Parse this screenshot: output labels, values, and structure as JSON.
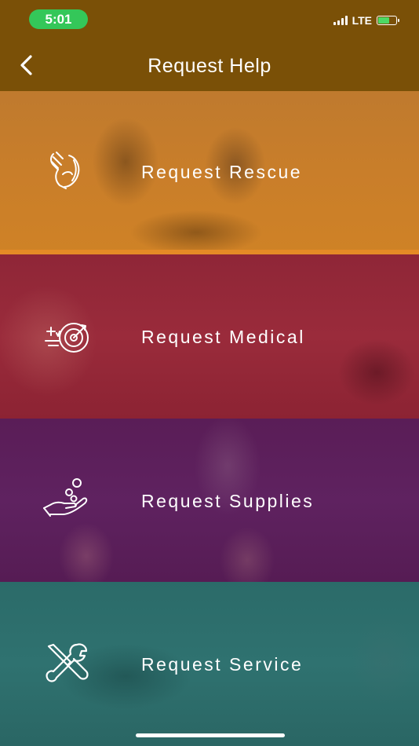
{
  "status_bar": {
    "time": "5:01",
    "network": "LTE"
  },
  "header": {
    "title": "Request Help",
    "back_icon": "chevron-left-icon"
  },
  "tiles": [
    {
      "label": "Request Rescue",
      "icon": "hands-rescue-icon",
      "color": "#c97e2a"
    },
    {
      "label": "Request Medical",
      "icon": "medical-target-icon",
      "color": "#9a2b3b"
    },
    {
      "label": "Request Supplies",
      "icon": "hand-coins-icon",
      "color": "#5f2260"
    },
    {
      "label": "Request Service",
      "icon": "wrench-screwdriver-icon",
      "color": "#2f7270"
    }
  ]
}
